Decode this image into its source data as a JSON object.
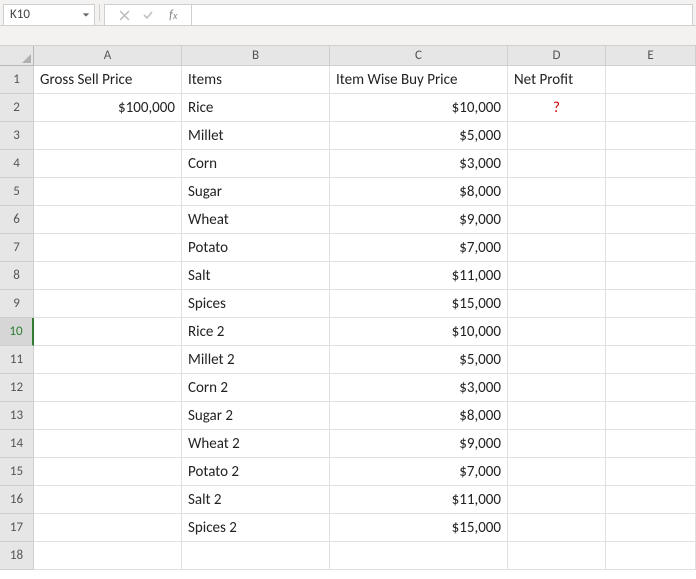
{
  "nameBox": "K10",
  "formula": "",
  "columns": [
    "A",
    "B",
    "C",
    "D",
    "E"
  ],
  "activeRow": 10,
  "headers": {
    "A": "Gross Sell Price",
    "B": "Items",
    "C": "Item Wise Buy Price",
    "D": "Net Profit"
  },
  "grossSellPrice": "$100,000",
  "netProfitPlaceholder": "?",
  "rows": [
    {
      "item": "Rice",
      "price": "$10,000"
    },
    {
      "item": "Millet",
      "price": "$5,000"
    },
    {
      "item": "Corn",
      "price": "$3,000"
    },
    {
      "item": "Sugar",
      "price": "$8,000"
    },
    {
      "item": "Wheat",
      "price": "$9,000"
    },
    {
      "item": "Potato",
      "price": "$7,000"
    },
    {
      "item": "Salt",
      "price": "$11,000"
    },
    {
      "item": "Spices",
      "price": "$15,000"
    },
    {
      "item": "Rice 2",
      "price": "$10,000"
    },
    {
      "item": "Millet 2",
      "price": "$5,000"
    },
    {
      "item": "Corn 2",
      "price": "$3,000"
    },
    {
      "item": "Sugar 2",
      "price": "$8,000"
    },
    {
      "item": "Wheat 2",
      "price": "$9,000"
    },
    {
      "item": "Potato 2",
      "price": "$7,000"
    },
    {
      "item": "Salt 2",
      "price": "$11,000"
    },
    {
      "item": "Spices 2",
      "price": "$15,000"
    }
  ],
  "emptyRows": [
    18
  ]
}
